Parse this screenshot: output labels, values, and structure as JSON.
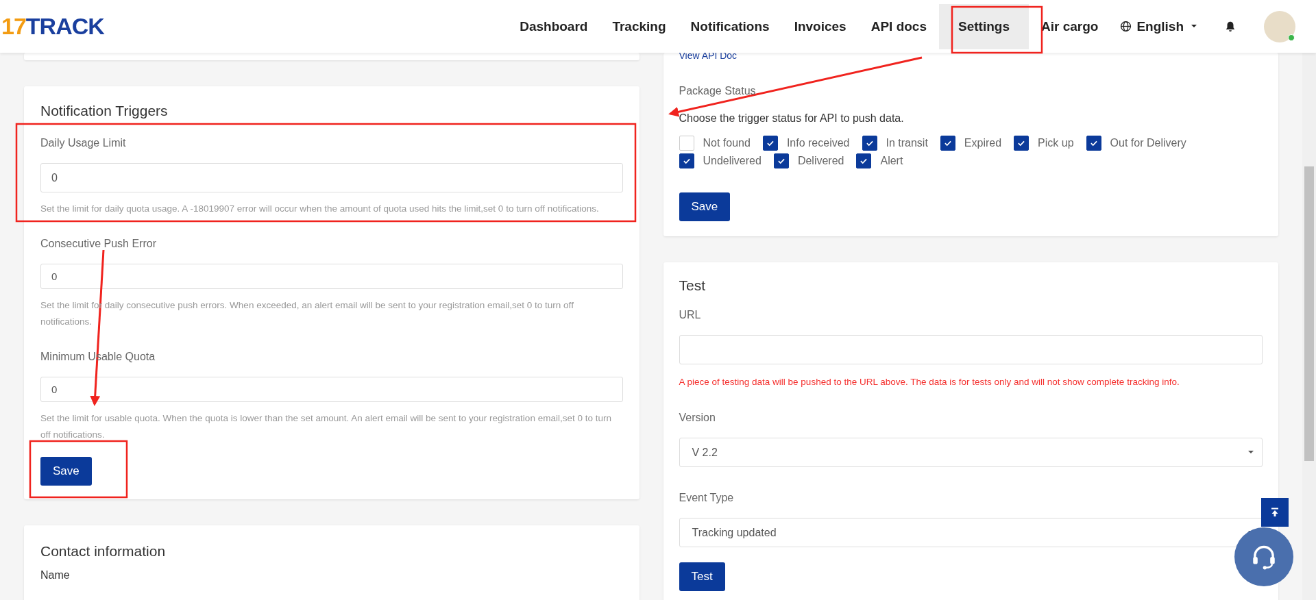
{
  "header": {
    "logo": {
      "number": "17",
      "name": "TRACK"
    },
    "nav": [
      {
        "label": "Dashboard",
        "selected": false
      },
      {
        "label": "Tracking",
        "selected": false
      },
      {
        "label": "Notifications",
        "selected": false
      },
      {
        "label": "Invoices",
        "selected": false
      },
      {
        "label": "API docs",
        "selected": false
      },
      {
        "label": "Settings",
        "selected": true
      },
      {
        "label": "Air cargo",
        "selected": false
      }
    ],
    "language": "English",
    "avatar": {
      "online": true
    }
  },
  "notification_triggers": {
    "title": "Notification Triggers",
    "fields": [
      {
        "label": "Daily Usage Limit",
        "value": "0",
        "help": "Set the limit for daily quota usage. A -18019907 error will occur when the amount of quota used hits the limit,set 0 to turn off notifications."
      },
      {
        "label": "Consecutive Push Error",
        "value": "0",
        "help": "Set the limit for daily consecutive push errors. When exceeded, an alert email will be sent to your registration email,set 0 to turn off notifications."
      },
      {
        "label": "Minimum Usable Quota",
        "value": "0",
        "help": "Set the limit for usable quota. When the quota is lower than the set amount. An alert email will be sent to your registration email,set 0 to turn off notifications."
      }
    ],
    "save": "Save"
  },
  "contact": {
    "title": "Contact information",
    "name_label": "Name"
  },
  "api_push": {
    "link": "View API Doc",
    "status_label": "Package Status",
    "prompt": "Choose the trigger status for API to push data.",
    "statuses": [
      {
        "label": "Not found",
        "checked": false
      },
      {
        "label": "Info received",
        "checked": true
      },
      {
        "label": "In transit",
        "checked": true
      },
      {
        "label": "Expired",
        "checked": true
      },
      {
        "label": "Pick up",
        "checked": true
      },
      {
        "label": "Out for Delivery",
        "checked": true
      },
      {
        "label": "Undelivered",
        "checked": true
      },
      {
        "label": "Delivered",
        "checked": true
      },
      {
        "label": "Alert",
        "checked": true
      }
    ],
    "save": "Save"
  },
  "test": {
    "title": "Test",
    "url_label": "URL",
    "url_help": "A piece of testing data will be pushed to the URL above. The data is for tests only and will not show complete tracking info.",
    "version_label": "Version",
    "version": "V 2.2",
    "event_label": "Event Type",
    "event": "Tracking updated",
    "button": "Test"
  }
}
